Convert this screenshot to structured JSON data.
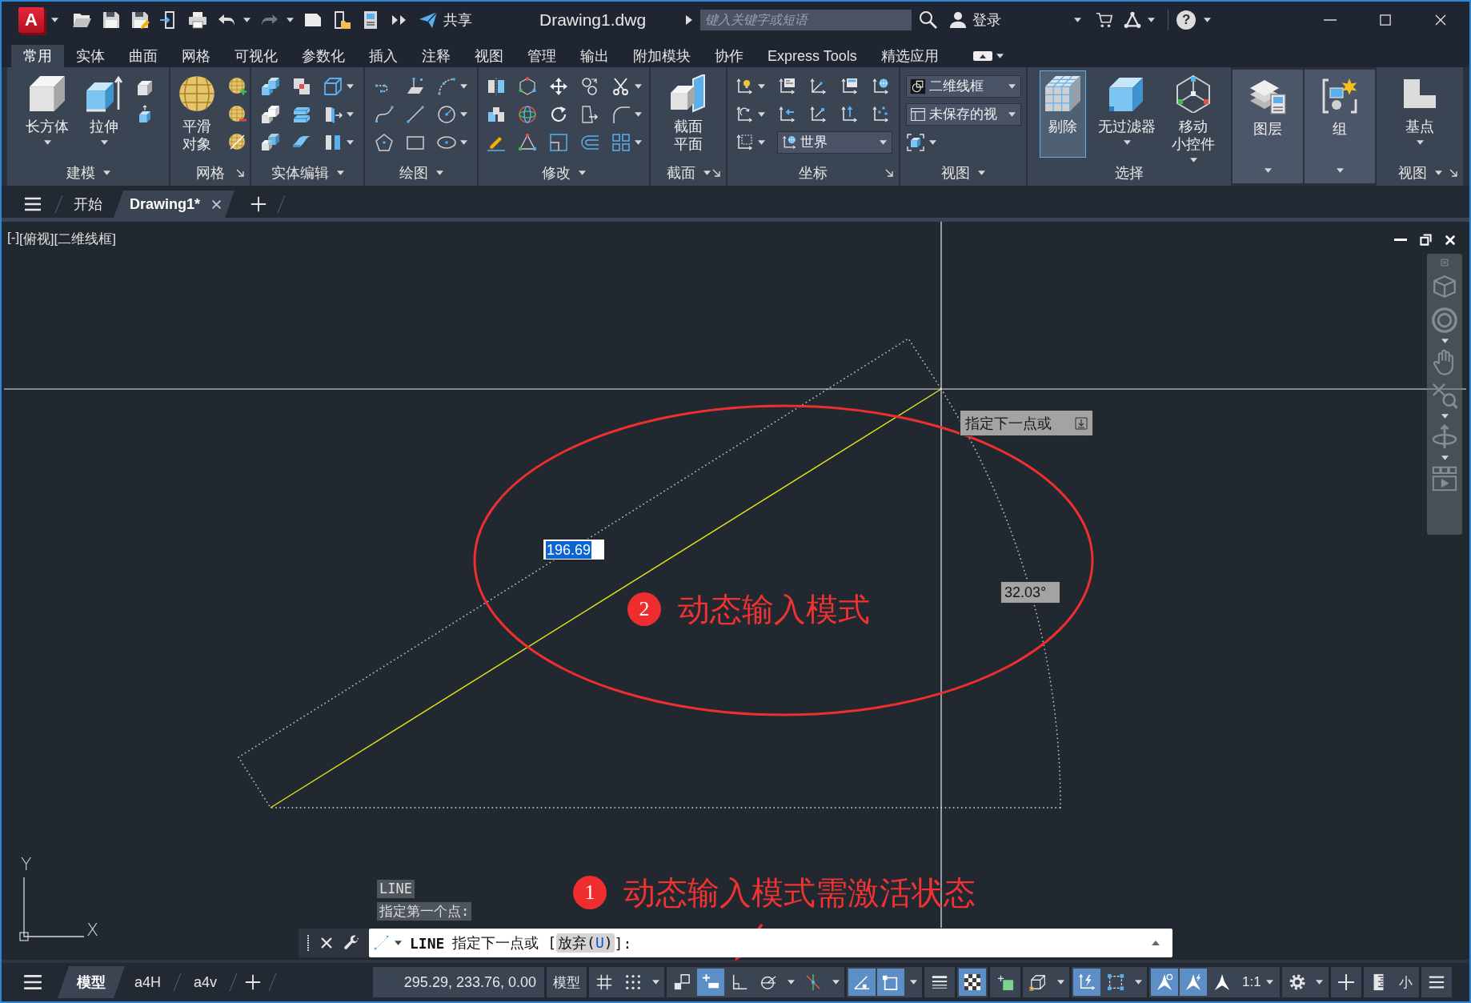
{
  "title_bar": {
    "logo": "A",
    "quick_access": [
      {
        "kind": "open",
        "dropdown": false,
        "disabled": false
      },
      {
        "kind": "save",
        "dropdown": false,
        "disabled": false
      },
      {
        "kind": "saveas",
        "dropdown": false,
        "disabled": false
      },
      {
        "kind": "export",
        "dropdown": false,
        "disabled": false
      },
      {
        "kind": "print",
        "dropdown": false,
        "disabled": false
      },
      {
        "kind": "undo",
        "dropdown": true,
        "disabled": false
      },
      {
        "kind": "redo",
        "dropdown": true,
        "disabled": true
      },
      {
        "kind": "page",
        "dropdown": false,
        "disabled": false
      },
      {
        "kind": "phonefolder",
        "dropdown": false,
        "disabled": false
      },
      {
        "kind": "monitor",
        "dropdown": false,
        "disabled": false
      },
      {
        "kind": "more",
        "dropdown": false,
        "disabled": false
      }
    ],
    "share": "共享",
    "title": "Drawing1.dwg",
    "search": {
      "placeholder": "键入关键字或短语"
    },
    "sign_in": "登录",
    "help": "?"
  },
  "ribbon": {
    "tabs": [
      {
        "label": "常用",
        "selected": true
      },
      {
        "label": "实体",
        "selected": false
      },
      {
        "label": "曲面",
        "selected": false
      },
      {
        "label": "网格",
        "selected": false
      },
      {
        "label": "可视化",
        "selected": false
      },
      {
        "label": "参数化",
        "selected": false
      },
      {
        "label": "插入",
        "selected": false
      },
      {
        "label": "注释",
        "selected": false
      },
      {
        "label": "视图",
        "selected": false
      },
      {
        "label": "管理",
        "selected": false
      },
      {
        "label": "输出",
        "selected": false
      },
      {
        "label": "附加模块",
        "selected": false
      },
      {
        "label": "协作",
        "selected": false
      },
      {
        "label": "Express Tools",
        "selected": false
      },
      {
        "label": "精选应用",
        "selected": false
      }
    ],
    "panels": [
      {
        "label": "建模",
        "menu": true,
        "launcher": false,
        "collapsed": false,
        "buttons": [
          {
            "kind": "box",
            "label": [
              "长方体"
            ],
            "dropdown": true,
            "on": false
          },
          {
            "kind": "extrude",
            "label": [
              "拉伸"
            ],
            "dropdown": true,
            "on": false
          }
        ],
        "rows": [
          [
            {
              "kind": "presspull",
              "dropdown": false
            }
          ],
          [
            {
              "kind": "smallcube",
              "dropdown": false
            }
          ]
        ]
      },
      {
        "label": "网格",
        "menu": false,
        "launcher": true,
        "collapsed": false,
        "buttons": [
          {
            "kind": "sphere",
            "label": [
              "平滑",
              "对象"
            ],
            "dropdown": false,
            "on": false
          }
        ],
        "rows": [
          [
            {
              "kind": "sphereplus",
              "dropdown": false
            }
          ],
          [
            {
              "kind": "sphereminus",
              "dropdown": false
            }
          ],
          [
            {
              "kind": "sphereslash",
              "dropdown": false
            }
          ]
        ]
      },
      {
        "label": "实体编辑",
        "menu": true,
        "launcher": false,
        "collapsed": false,
        "rows": [
          [
            {
              "kind": "union",
              "dropdown": false
            },
            {
              "kind": "subtract",
              "dropdown": false
            },
            {
              "kind": "wirecube",
              "dropdown": true
            }
          ],
          [
            {
              "kind": "intersect",
              "dropdown": false
            },
            {
              "kind": "slice",
              "dropdown": false
            },
            {
              "kind": "extrudeface",
              "dropdown": true
            }
          ],
          [
            {
              "kind": "interfere",
              "dropdown": false
            },
            {
              "kind": "thicken",
              "dropdown": false
            },
            {
              "kind": "separate",
              "dropdown": true
            }
          ]
        ]
      },
      {
        "label": "绘图",
        "menu": true,
        "launcher": false,
        "collapsed": false,
        "rows": [
          [
            {
              "kind": "polyline",
              "dropdown": false
            },
            {
              "kind": "plane",
              "dropdown": false
            },
            {
              "kind": "arc",
              "dropdown": true
            }
          ],
          [
            {
              "kind": "spline",
              "dropdown": false
            },
            {
              "kind": "line",
              "dropdown": false
            },
            {
              "kind": "circle",
              "dropdown": true
            }
          ],
          [
            {
              "kind": "pentagon",
              "dropdown": false
            },
            {
              "kind": "rectangle",
              "dropdown": false
            },
            {
              "kind": "ellipse",
              "dropdown": true
            }
          ]
        ]
      },
      {
        "label": "修改",
        "menu": true,
        "launcher": false,
        "collapsed": false,
        "rows": [
          [
            {
              "kind": "mirror",
              "dropdown": false
            },
            {
              "kind": "align",
              "dropdown": false
            },
            {
              "kind": "move",
              "dropdown": false
            },
            {
              "kind": "copy",
              "dropdown": false
            },
            {
              "kind": "trim",
              "dropdown": true
            }
          ],
          [
            {
              "kind": "stretch",
              "dropdown": false
            },
            {
              "kind": "orbit",
              "dropdown": false
            },
            {
              "kind": "rotate",
              "dropdown": false
            },
            {
              "kind": "stretch2",
              "dropdown": false
            },
            {
              "kind": "fillet",
              "dropdown": true
            }
          ],
          [
            {
              "kind": "erase",
              "dropdown": false
            },
            {
              "kind": "triaxes",
              "dropdown": false
            },
            {
              "kind": "scale",
              "dropdown": false
            },
            {
              "kind": "offset",
              "dropdown": false
            },
            {
              "kind": "array",
              "dropdown": true
            }
          ]
        ]
      },
      {
        "label": "截面",
        "menu": true,
        "launcher": true,
        "collapsed": false,
        "buttons": [
          {
            "kind": "section",
            "label": [
              "截面",
              "平面"
            ],
            "dropdown": false,
            "on": false
          }
        ]
      },
      {
        "label": "坐标",
        "menu": false,
        "launcher": true,
        "collapsed": false,
        "rows": [
          [
            {
              "kind": "ucslight",
              "dropdown": true
            },
            {
              "kind": "ucsnamed",
              "dropdown": false
            },
            {
              "kind": "ucsorigin",
              "dropdown": false
            },
            {
              "kind": "ucsview",
              "dropdown": false
            },
            {
              "kind": "ucsworld",
              "dropdown": false
            }
          ],
          [
            {
              "kind": "ucsrotate",
              "dropdown": true
            },
            {
              "kind": "ucsprev",
              "dropdown": false
            },
            {
              "kind": "ucsobj",
              "dropdown": false
            },
            {
              "kind": "ucsz",
              "dropdown": false
            },
            {
              "kind": "ucs3",
              "dropdown": false
            }
          ],
          [
            {
              "kind": "ucsface",
              "dropdown": true
            },
            {
              "kind": "world",
              "value": "世界"
            }
          ]
        ]
      },
      {
        "label": "视图",
        "menu": true,
        "launcher": false,
        "collapsed": false,
        "rows": [
          [
            {
              "kind": "style",
              "value": "二维线框"
            }
          ],
          [
            {
              "kind": "views",
              "value": "未保存的视"
            }
          ],
          [
            {
              "kind": "viewcube",
              "dropdown": true
            }
          ]
        ]
      },
      {
        "label": "选择",
        "menu": false,
        "launcher": false,
        "collapsed": false,
        "buttons": [
          {
            "kind": "cull",
            "label": [
              "剔除"
            ],
            "dropdown": false,
            "on": true
          },
          {
            "kind": "nofilter",
            "label": [
              "无过滤器"
            ],
            "dropdown": true,
            "on": false
          },
          {
            "kind": "gizmo",
            "label": [
              "移动",
              "小控件"
            ],
            "dropdown": true,
            "on": false
          }
        ]
      },
      {
        "menu": true,
        "launcher": false,
        "collapsed": true,
        "buttons": [
          {
            "kind": "layers",
            "label": [
              "图层"
            ],
            "dropdown": false,
            "on": false
          }
        ]
      },
      {
        "menu": true,
        "launcher": false,
        "collapsed": true,
        "buttons": [
          {
            "kind": "group",
            "label": [
              "组"
            ],
            "dropdown": false,
            "on": false
          }
        ]
      },
      {
        "label": "视图",
        "menu": true,
        "launcher": true,
        "collapsed": false,
        "buttons": [
          {
            "kind": "basepoint",
            "label": [
              "基点"
            ],
            "dropdown": true,
            "on": false
          }
        ]
      }
    ]
  },
  "doc_tabs": [
    {
      "label": "开始",
      "selected": false,
      "closable": false
    },
    {
      "label": "Drawing1*",
      "selected": true,
      "closable": true
    }
  ],
  "viewport": {
    "menus": [
      "[-]",
      "[俯视]",
      "[二维线框]"
    ],
    "tooltip": "指定下一点或",
    "distance": "196.69",
    "angle": "32.03°",
    "axes": {
      "x": "X",
      "y": "Y"
    },
    "annotations": [
      {
        "number": "2",
        "text": "动态输入模式"
      },
      {
        "number": "1",
        "text": "动态输入模式需激活状态"
      }
    ]
  },
  "command_line": {
    "history": [
      "LINE",
      "指定第一个点:"
    ],
    "command": "LINE",
    "prompt": "指定下一点或 [",
    "option": {
      "label": "放弃(",
      "key": "U",
      "end": ")"
    },
    "end": "]:"
  },
  "status_bar": {
    "layouts": [
      {
        "label": "模型",
        "selected": true
      },
      {
        "label": "a4H",
        "selected": false
      },
      {
        "label": "a4v",
        "selected": false
      }
    ],
    "coordinates": "295.29, 233.76, 0.00",
    "groups": [
      [
        {
          "value": "模型",
          "dropdown": false
        }
      ],
      [
        {
          "kind": "grid",
          "on": false,
          "dropdown": false
        },
        {
          "kind": "snap",
          "on": false,
          "dropdown": true
        }
      ],
      [
        {
          "kind": "infer",
          "on": false,
          "dropdown": false
        },
        {
          "kind": "dynin",
          "on": true,
          "dropdown": false
        },
        {
          "kind": "ortho",
          "on": false,
          "dropdown": false
        },
        {
          "kind": "polar",
          "on": false,
          "dropdown": true
        },
        {
          "kind": "iso",
          "on": false,
          "dropdown": true
        }
      ],
      [
        {
          "kind": "otrack",
          "on": true,
          "dropdown": false
        },
        {
          "kind": "osnap",
          "on": true,
          "dropdown": true
        }
      ],
      [
        {
          "kind": "lweight",
          "on": false,
          "dropdown": false
        }
      ],
      [
        {
          "kind": "transp",
          "on": true,
          "dropdown": false
        }
      ],
      [
        {
          "kind": "selcycle",
          "on": false,
          "dropdown": false
        }
      ],
      [
        {
          "kind": "osnap3d",
          "on": false,
          "dropdown": true
        }
      ],
      [
        {
          "kind": "ducs",
          "on": true,
          "dropdown": false
        },
        {
          "kind": "selfilter",
          "on": false,
          "dropdown": true
        }
      ],
      [
        {
          "kind": "annovis",
          "on": true,
          "dropdown": false
        },
        {
          "kind": "autoscale",
          "on": true,
          "dropdown": false
        },
        {
          "kind": "annoscale",
          "on": false,
          "dropdown": false
        },
        {
          "value": "1:1",
          "dropdown": true
        }
      ],
      [
        {
          "kind": "gear",
          "dropdown": true
        }
      ],
      [
        {
          "kind": "plus",
          "dropdown": false
        }
      ],
      [
        {
          "kind": "ruler",
          "dropdown": false
        },
        {
          "value": "小",
          "dropdown": false
        }
      ],
      [
        {
          "kind": "menu",
          "dropdown": false
        }
      ]
    ]
  }
}
